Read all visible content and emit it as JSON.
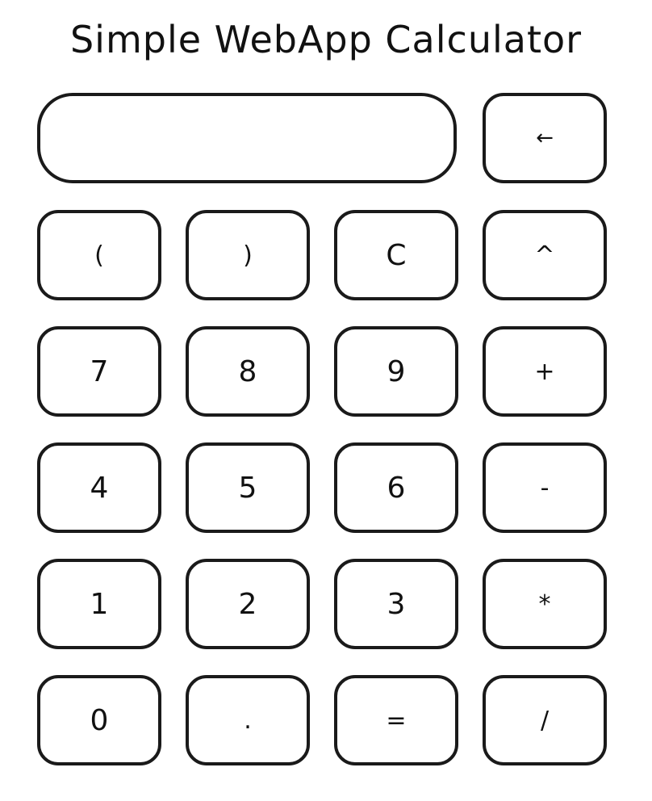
{
  "app": {
    "title": "Simple WebApp Calculator"
  },
  "display": {
    "value": ""
  },
  "keys": {
    "backspace": "←",
    "open_paren": "(",
    "close_paren": ")",
    "clear": "C",
    "power": "^",
    "seven": "7",
    "eight": "8",
    "nine": "9",
    "plus": "+",
    "four": "4",
    "five": "5",
    "six": "6",
    "minus": "-",
    "one": "1",
    "two": "2",
    "three": "3",
    "multiply": "*",
    "zero": "0",
    "decimal": ".",
    "equals": "=",
    "divide": "/"
  }
}
